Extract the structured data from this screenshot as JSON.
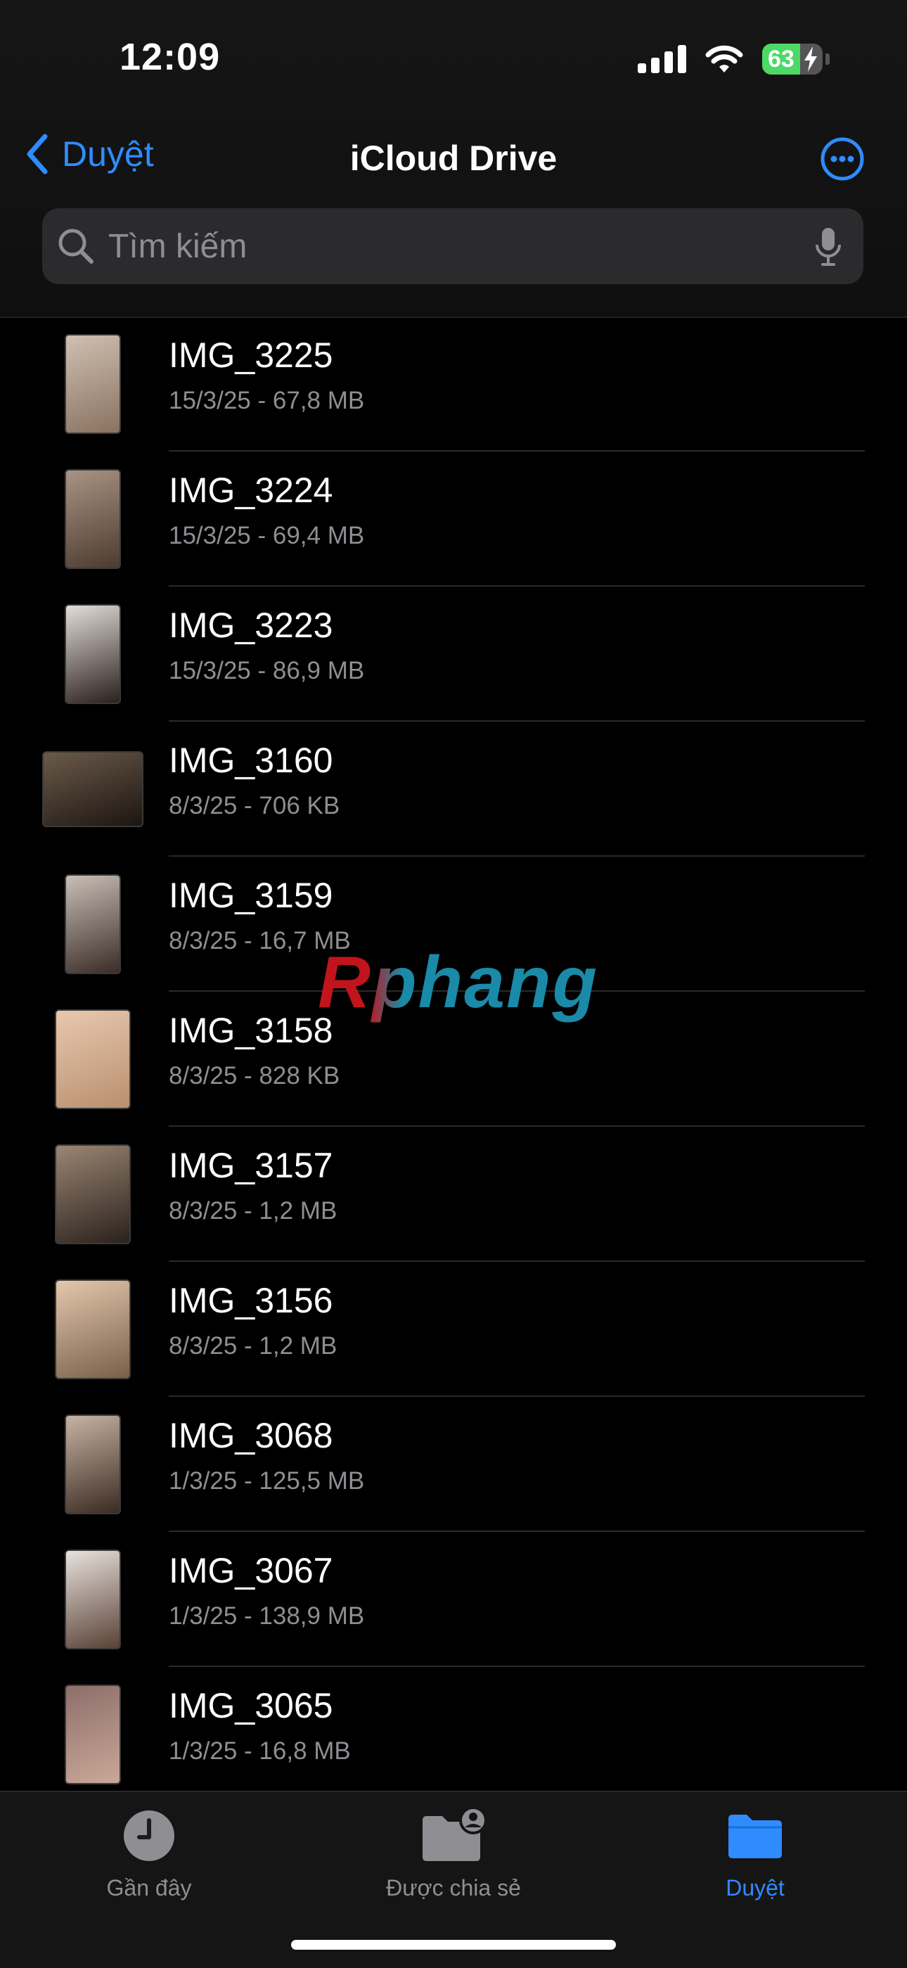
{
  "status_bar": {
    "time": "12:09",
    "battery_percent": "63",
    "battery_level": 0.63,
    "battery_color": "#4cd964"
  },
  "nav": {
    "back_label": "Duyệt",
    "title": "iCloud Drive",
    "more_icon": "ellipsis-circle-icon",
    "accent_color": "#2f8cff"
  },
  "search": {
    "placeholder": "Tìm kiếm",
    "value": ""
  },
  "files": [
    {
      "name": "IMG_3225",
      "meta": "15/3/25 - 67,8 MB",
      "orientation": "portrait"
    },
    {
      "name": "IMG_3224",
      "meta": "15/3/25 - 69,4 MB",
      "orientation": "portrait"
    },
    {
      "name": "IMG_3223",
      "meta": "15/3/25 - 86,9 MB",
      "orientation": "portrait"
    },
    {
      "name": "IMG_3160",
      "meta": "8/3/25 - 706 KB",
      "orientation": "landscape"
    },
    {
      "name": "IMG_3159",
      "meta": "8/3/25 - 16,7 MB",
      "orientation": "portrait"
    },
    {
      "name": "IMG_3158",
      "meta": "8/3/25 - 828 KB",
      "orientation": "portrait-wide"
    },
    {
      "name": "IMG_3157",
      "meta": "8/3/25 - 1,2 MB",
      "orientation": "portrait-wide"
    },
    {
      "name": "IMG_3156",
      "meta": "8/3/25 - 1,2 MB",
      "orientation": "portrait-wide"
    },
    {
      "name": "IMG_3068",
      "meta": "1/3/25 - 125,5 MB",
      "orientation": "portrait"
    },
    {
      "name": "IMG_3067",
      "meta": "1/3/25 - 138,9 MB",
      "orientation": "portrait"
    },
    {
      "name": "IMG_3065",
      "meta": "1/3/25 - 16,8 MB",
      "orientation": "portrait"
    }
  ],
  "watermark": "Rphang",
  "tabs": [
    {
      "label": "Gần đây",
      "icon": "clock-icon",
      "active": false
    },
    {
      "label": "Được chia sẻ",
      "icon": "shared-folder-icon",
      "active": false
    },
    {
      "label": "Duyệt",
      "icon": "folder-icon",
      "active": true
    }
  ]
}
